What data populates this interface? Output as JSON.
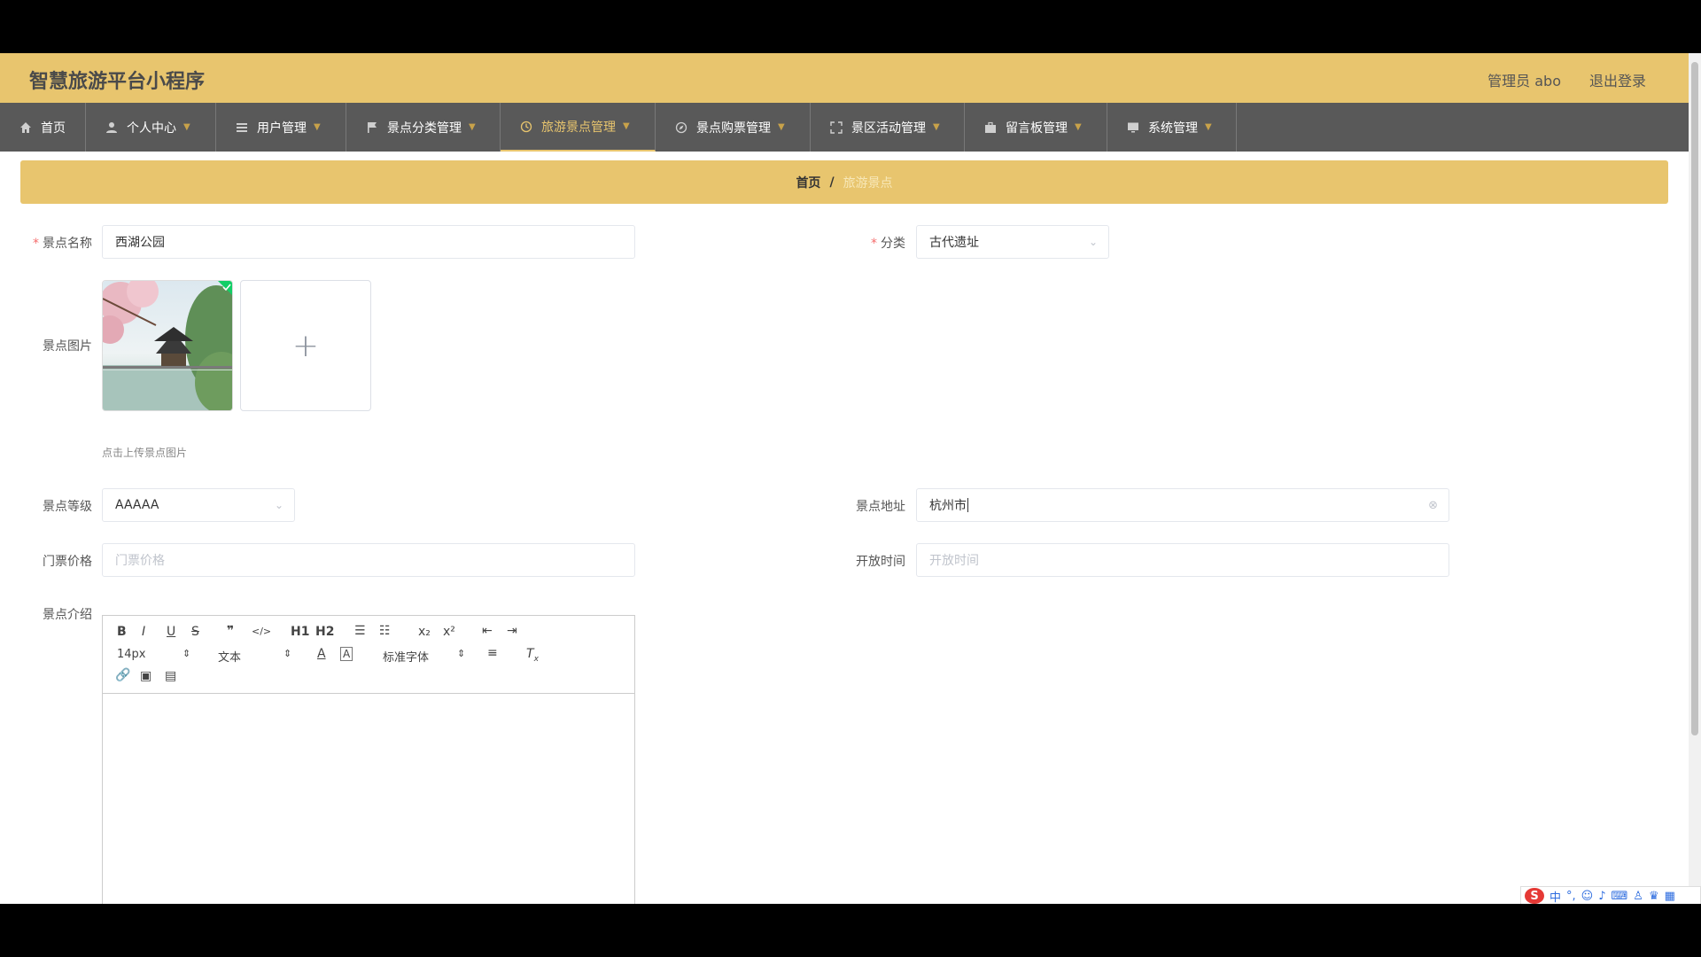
{
  "header": {
    "title": "智慧旅游平台小程序",
    "admin": "管理员 abo",
    "logout": "退出登录"
  },
  "nav": [
    {
      "label": "首页",
      "icon": "home-icon",
      "chevron": false,
      "active": false
    },
    {
      "label": "个人中心",
      "icon": "user-icon",
      "chevron": true,
      "active": false
    },
    {
      "label": "用户管理",
      "icon": "list-icon",
      "chevron": true,
      "active": false
    },
    {
      "label": "景点分类管理",
      "icon": "flag-icon",
      "chevron": true,
      "active": false
    },
    {
      "label": "旅游景点管理",
      "icon": "clock-icon",
      "chevron": true,
      "active": true
    },
    {
      "label": "景点购票管理",
      "icon": "compass-icon",
      "chevron": true,
      "active": false
    },
    {
      "label": "景区活动管理",
      "icon": "fullscreen-icon",
      "chevron": true,
      "active": false
    },
    {
      "label": "留言板管理",
      "icon": "briefcase-icon",
      "chevron": true,
      "active": false
    },
    {
      "label": "系统管理",
      "icon": "monitor-icon",
      "chevron": true,
      "active": false
    }
  ],
  "breadcrumb": {
    "home": "首页",
    "separator": "/",
    "current": "旅游景点"
  },
  "form": {
    "name_label": "景点名称",
    "name_value": "西湖公园",
    "category_label": "分类",
    "category_value": "古代遗址",
    "image_label": "景点图片",
    "upload_hint": "点击上传景点图片",
    "level_label": "景点等级",
    "level_value": "AAAAA",
    "address_label": "景点地址",
    "address_value": "杭州市",
    "price_label": "门票价格",
    "price_placeholder": "门票价格",
    "opentime_label": "开放时间",
    "opentime_placeholder": "开放时间",
    "intro_label": "景点介绍"
  },
  "editor": {
    "font_size": "14px",
    "text_type": "文本",
    "font_family": "标准字体",
    "buttons": [
      "B",
      "I",
      "U",
      "S",
      "❞",
      "</>",
      "H1",
      "H2",
      "ordered-list",
      "bullet-list",
      "x₂",
      "x²",
      "outdent",
      "indent"
    ]
  },
  "ime": {
    "label": "中"
  }
}
